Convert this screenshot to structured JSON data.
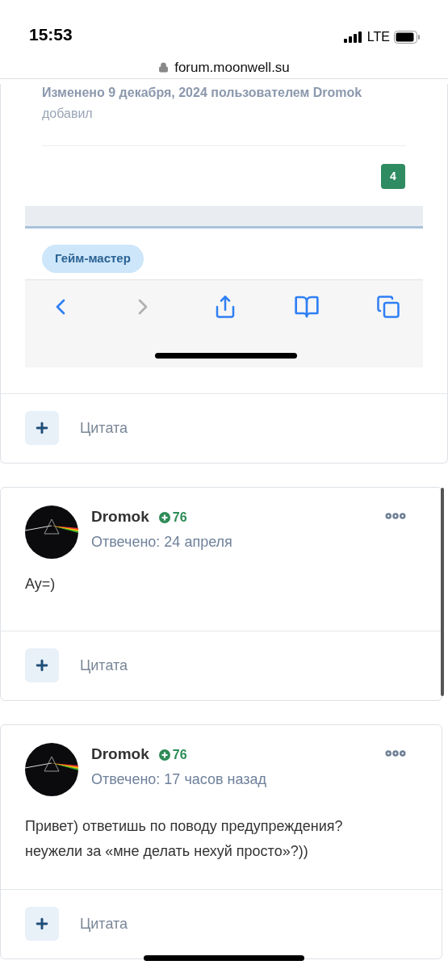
{
  "status_bar": {
    "time": "15:53",
    "network": "LTE"
  },
  "address_bar": {
    "url": "forum.moonwell.su"
  },
  "top_post": {
    "screenshot": {
      "edit_note": "Изменено 9 декабря, 2024 пользователем Dromok",
      "edit_reason": "добавил",
      "reaction_count": "4",
      "role_badge": "Гейм-мастер",
      "browser_toolbar": {
        "back_disabled": false,
        "forward_disabled": true
      }
    },
    "quote_button": "Цитата"
  },
  "posts": [
    {
      "author": "Dromok",
      "reputation": "76",
      "replied": "Отвечено: 24 апреля",
      "body": "Ау=)",
      "quote_button": "Цитата"
    },
    {
      "author": "Dromok",
      "reputation": "76",
      "replied": "Отвечено: 17 часов назад",
      "body": "Привет) ответишь по поводу предупреждения?\nнеужели за «мне делать нехуй просто»?))",
      "quote_button": "Цитата"
    }
  ]
}
